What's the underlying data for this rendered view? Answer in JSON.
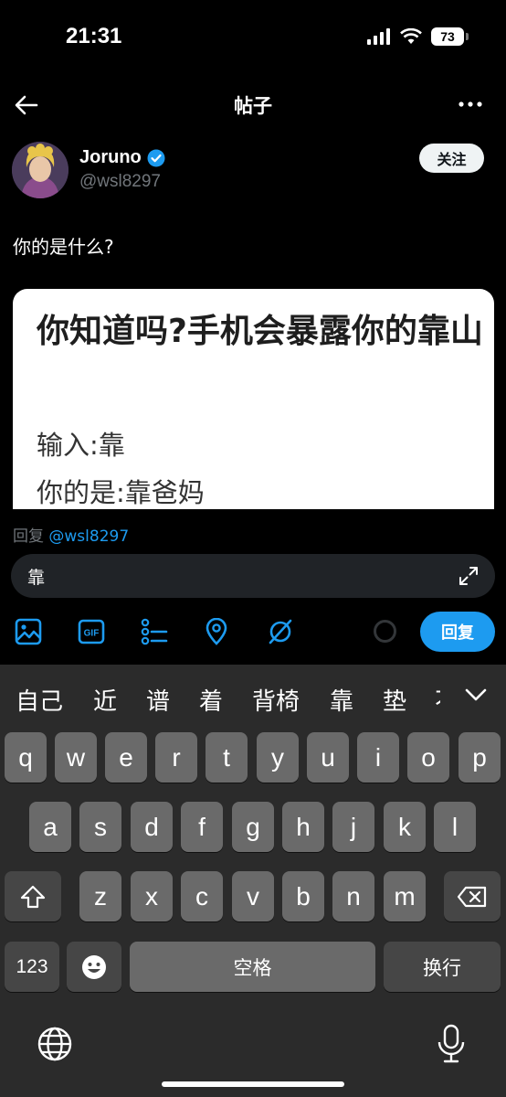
{
  "status": {
    "time": "21:31",
    "battery": "73"
  },
  "nav": {
    "title": "帖子"
  },
  "post": {
    "author_name": "Joruno",
    "author_handle": "@wsl8297",
    "follow_label": "关注",
    "text": "你的是什么?",
    "image": {
      "title": "你知道吗?手机会暴露你的靠山",
      "line1": "输入:靠",
      "line2": "你的是:靠爸妈"
    }
  },
  "composer": {
    "reply_prefix": "回复",
    "reply_mention": "@wsl8297",
    "input_value": "靠",
    "reply_button": "回复"
  },
  "keyboard": {
    "candidates": [
      "自己",
      "近",
      "谱",
      "着",
      "背椅",
      "靠",
      "垫",
      "不"
    ],
    "row1": [
      "q",
      "w",
      "e",
      "r",
      "t",
      "y",
      "u",
      "i",
      "o",
      "p"
    ],
    "row2": [
      "a",
      "s",
      "d",
      "f",
      "g",
      "h",
      "j",
      "k",
      "l"
    ],
    "row3": [
      "z",
      "x",
      "c",
      "v",
      "b",
      "n",
      "m"
    ],
    "numbers_key": "123",
    "space_key": "空格",
    "return_key": "换行"
  },
  "colors": {
    "accent": "#1d9bf0",
    "handle": "#71767b",
    "keyboard_bg": "#2b2b2b",
    "key": "#6a6a6a"
  }
}
